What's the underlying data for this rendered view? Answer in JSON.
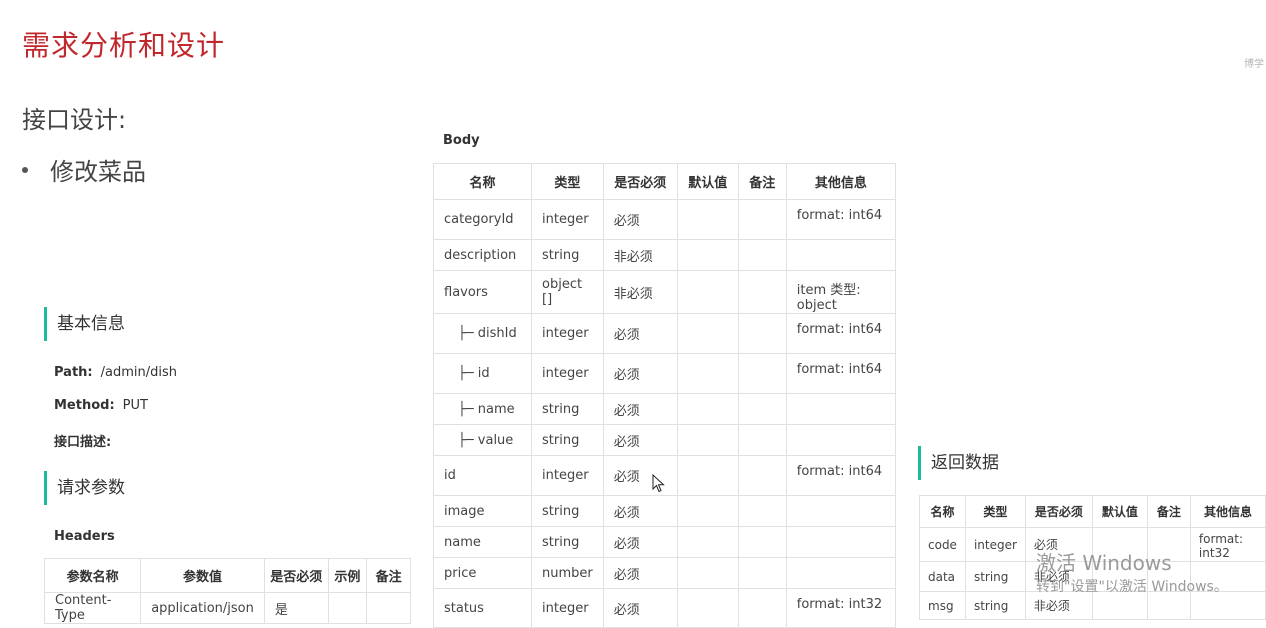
{
  "slide": {
    "title": "需求分析和设计",
    "corner_mark": "博学",
    "section": "接口设计:",
    "bullet": "修改菜品"
  },
  "basic_info": {
    "heading": "基本信息",
    "path_label": "Path:",
    "path_value": "/admin/dish",
    "method_label": "Method:",
    "method_value": "PUT",
    "desc_label": "接口描述:"
  },
  "request_params": {
    "heading": "请求参数",
    "headers_label": "Headers",
    "columns": [
      "参数名称",
      "参数值",
      "是否必须",
      "示例",
      "备注"
    ],
    "rows": [
      [
        "Content-Type",
        "application/json",
        "是",
        "",
        ""
      ]
    ]
  },
  "body": {
    "label": "Body",
    "columns": [
      "名称",
      "类型",
      "是否必须",
      "默认值",
      "备注",
      "其他信息"
    ],
    "rows": [
      {
        "name": "categoryId",
        "type": "integer",
        "required": "必须",
        "default": "",
        "remark": "",
        "info": "format: int64",
        "indent": false
      },
      {
        "name": "description",
        "type": "string",
        "required": "非必须",
        "default": "",
        "remark": "",
        "info": "",
        "indent": false
      },
      {
        "name": "flavors",
        "type": "object []",
        "required": "非必须",
        "default": "",
        "remark": "",
        "info": "item 类型: object",
        "indent": false
      },
      {
        "name": "├─ dishId",
        "type": "integer",
        "required": "必须",
        "default": "",
        "remark": "",
        "info": "format: int64",
        "indent": true
      },
      {
        "name": "├─ id",
        "type": "integer",
        "required": "必须",
        "default": "",
        "remark": "",
        "info": "format: int64",
        "indent": true
      },
      {
        "name": "├─ name",
        "type": "string",
        "required": "必须",
        "default": "",
        "remark": "",
        "info": "",
        "indent": true
      },
      {
        "name": "├─ value",
        "type": "string",
        "required": "必须",
        "default": "",
        "remark": "",
        "info": "",
        "indent": true
      },
      {
        "name": "id",
        "type": "integer",
        "required": "必须",
        "default": "",
        "remark": "",
        "info": "format: int64",
        "indent": false
      },
      {
        "name": "image",
        "type": "string",
        "required": "必须",
        "default": "",
        "remark": "",
        "info": "",
        "indent": false
      },
      {
        "name": "name",
        "type": "string",
        "required": "必须",
        "default": "",
        "remark": "",
        "info": "",
        "indent": false
      },
      {
        "name": "price",
        "type": "number",
        "required": "必须",
        "default": "",
        "remark": "",
        "info": "",
        "indent": false
      },
      {
        "name": "status",
        "type": "integer",
        "required": "必须",
        "default": "",
        "remark": "",
        "info": "format: int32",
        "indent": false
      }
    ]
  },
  "response": {
    "heading": "返回数据",
    "columns": [
      "名称",
      "类型",
      "是否必须",
      "默认值",
      "备注",
      "其他信息"
    ],
    "rows": [
      {
        "name": "code",
        "type": "integer",
        "required": "必须",
        "default": "",
        "remark": "",
        "info": "format: int32"
      },
      {
        "name": "data",
        "type": "string",
        "required": "非必须",
        "default": "",
        "remark": "",
        "info": ""
      },
      {
        "name": "msg",
        "type": "string",
        "required": "非必须",
        "default": "",
        "remark": "",
        "info": ""
      }
    ]
  },
  "activation": {
    "line1": "激活 Windows",
    "line2": "转到\"设置\"以激活 Windows。"
  },
  "colors": {
    "title": "#c0282d",
    "accent_bar": "#1abc9c",
    "border": "#e0e0e0"
  }
}
